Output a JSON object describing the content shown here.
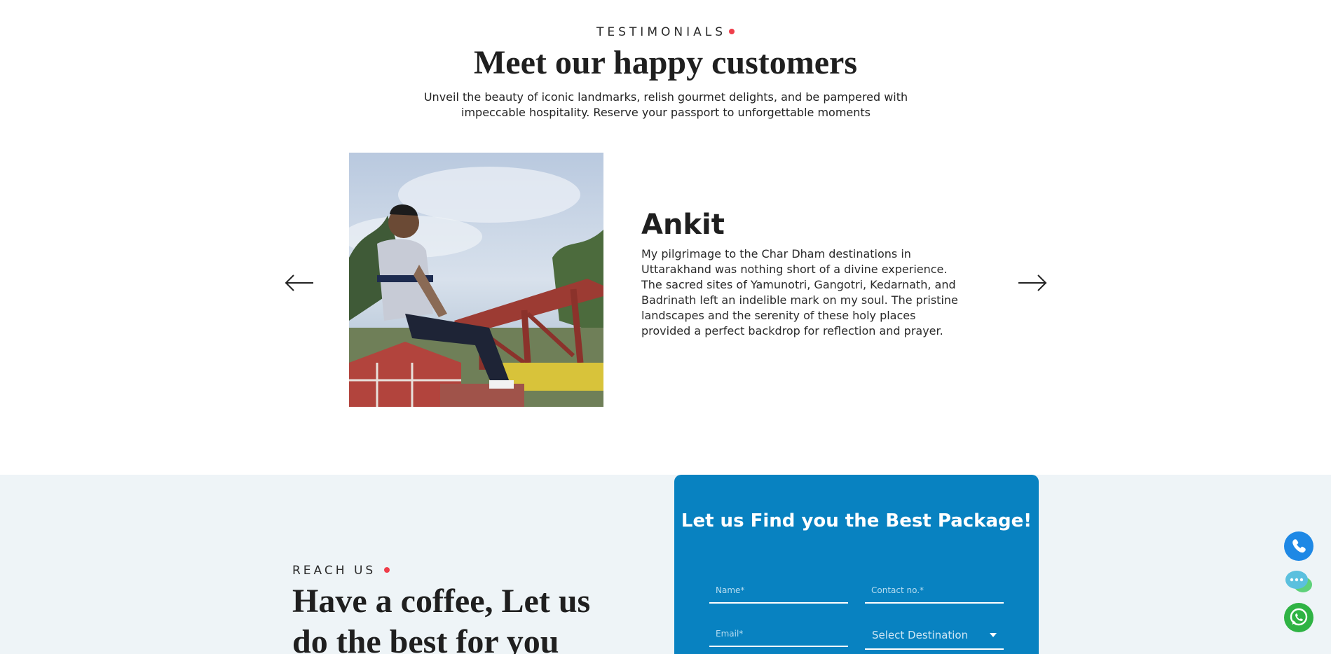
{
  "testimonials": {
    "eyebrow": "TESTIMONIALS",
    "title": "Meet our happy customers",
    "subtitle": "Unveil the beauty of iconic landmarks, relish gourmet delights, and be pampered with impeccable hospitality. Reserve your passport to unforgettable moments",
    "current": {
      "name": "Ankit",
      "quote": "My pilgrimage to the Char Dham destinations in Uttarakhand was nothing short of a divine experience. The sacred sites of Yamunotri, Gangotri, Kedarnath, and Badrinath left an indelible mark on my soul. The pristine landscapes and the serenity of these holy places provided a perfect backdrop for reflection and prayer."
    },
    "prev_icon": "arrow-left-icon",
    "next_icon": "arrow-right-icon"
  },
  "reach": {
    "eyebrow": "REACH US",
    "title": "Have a coffee, Let us do the best for you"
  },
  "form": {
    "title": "Let us Find you the Best Package!",
    "name_placeholder": "Name*",
    "contact_placeholder": "Contact no.*",
    "email_placeholder": "Email*",
    "destination_selected": "Select Destination"
  },
  "floating_actions": [
    {
      "icon": "phone-icon",
      "color": "#1e88e5"
    },
    {
      "icon": "chat-icon",
      "color": "#5bc0de"
    },
    {
      "icon": "whatsapp-icon",
      "color": "#2fb344"
    }
  ],
  "colors": {
    "accent_dot": "#ef3e4a",
    "form_bg": "#0882c1",
    "section_bg": "#eef4f7"
  }
}
